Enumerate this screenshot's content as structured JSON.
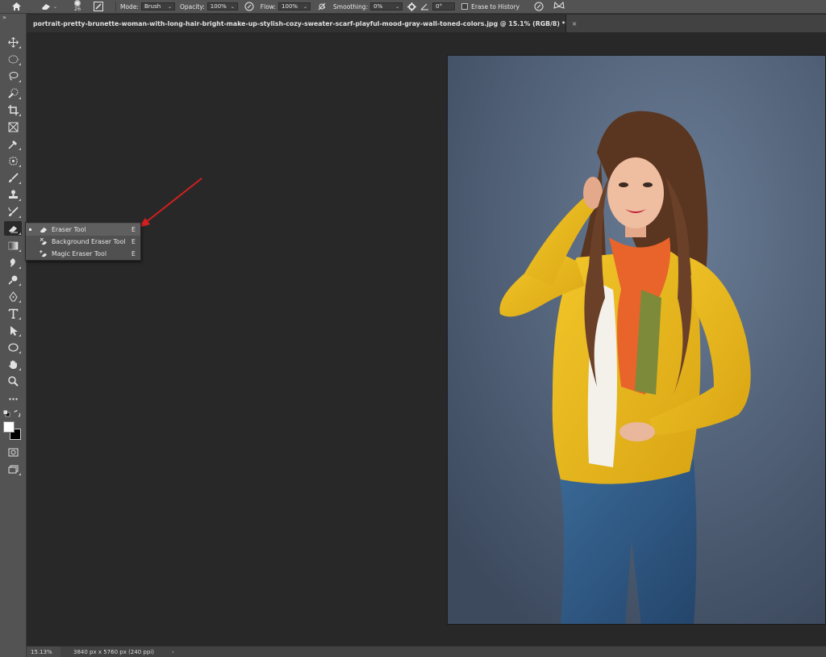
{
  "options_bar": {
    "brush_size": "26",
    "mode_label": "Mode:",
    "mode_value": "Brush",
    "opacity_label": "Opacity:",
    "opacity_value": "100%",
    "flow_label": "Flow:",
    "flow_value": "100%",
    "smoothing_label": "Smoothing:",
    "smoothing_value": "0%",
    "angle_value": "0°",
    "erase_to_history_label": "Erase to History"
  },
  "document_tab": {
    "title": "portrait-pretty-brunette-woman-with-long-hair-bright-make-up-stylish-cozy-sweater-scarf-playful-mood-gray-wall-toned-colors.jpg @ 15.1% (RGB/8) *",
    "close_glyph": "×"
  },
  "toolbar": {
    "collapse_glyph": "»"
  },
  "flyout": {
    "items": [
      {
        "label": "Eraser Tool",
        "shortcut": "E",
        "icon": "eraser-icon"
      },
      {
        "label": "Background Eraser Tool",
        "shortcut": "E",
        "icon": "background-eraser-icon"
      },
      {
        "label": "Magic Eraser Tool",
        "shortcut": "E",
        "icon": "magic-eraser-icon"
      }
    ]
  },
  "status_bar": {
    "zoom": "15.13%",
    "doc_info": "3840 px x 5760 px (240 ppi)",
    "arrow": "›"
  },
  "colors": {
    "ui_dark": "#282828",
    "ui_panel": "#535353",
    "annotation_arrow": "#d21f1f",
    "jacket": "#e8b81c",
    "scarf": "#e8642a",
    "jeans": "#2f5a86"
  }
}
